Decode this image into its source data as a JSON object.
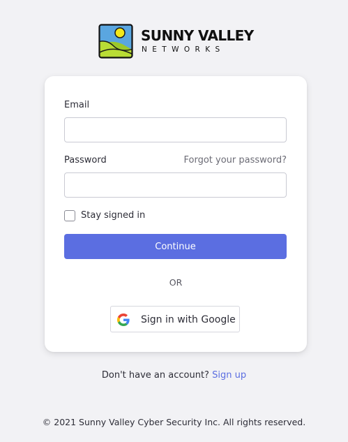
{
  "brand": {
    "name": "SUNNY VALLEY",
    "subtitle": "NETWORKS"
  },
  "form": {
    "email_label": "Email",
    "email_value": "",
    "password_label": "Password",
    "password_value": "",
    "forgot_password_label": "Forgot your password?",
    "stay_signed_in_label": "Stay signed in",
    "stay_signed_in_checked": false,
    "continue_label": "Continue",
    "or_label": "OR",
    "google_label": "Sign in with Google"
  },
  "signup": {
    "prompt": "Don't have an account?",
    "link_label": "Sign up"
  },
  "footer": {
    "copyright": "© 2021 Sunny Valley Cyber Security Inc. All rights reserved."
  },
  "colors": {
    "accent": "#5b6ee1",
    "background": "#f2f2f5",
    "card": "#ffffff"
  },
  "icons": {
    "logo": "sunny-valley-logo",
    "google": "google-g-icon"
  }
}
